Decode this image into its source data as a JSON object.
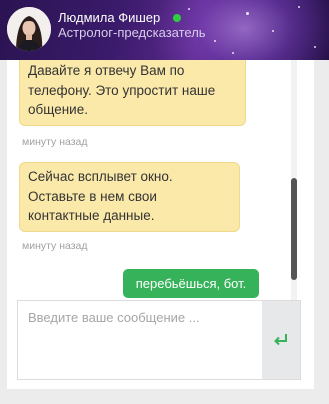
{
  "header": {
    "agent_name": "Людмила Фишер",
    "agent_role": "Астролог-предсказатель",
    "status": "online",
    "status_color": "#2ecc40"
  },
  "messages": [
    {
      "type": "incoming",
      "text": "Давайте я отвечу Вам по телефону. Это упростит наше общение.",
      "time": "минуту назад"
    },
    {
      "type": "incoming",
      "text": "Сейчас всплывет окно. Оставьте в нем свои контактные данные.",
      "time": "минуту назад"
    },
    {
      "type": "outgoing",
      "text": "перебьёшься, бот."
    }
  ],
  "composer": {
    "placeholder": "Введите ваше сообщение ...",
    "send_icon": "enter-arrow-icon"
  },
  "colors": {
    "incoming_bubble": "#fbe9aa",
    "outgoing_bubble": "#36b35a",
    "accent": "#36b35a"
  }
}
